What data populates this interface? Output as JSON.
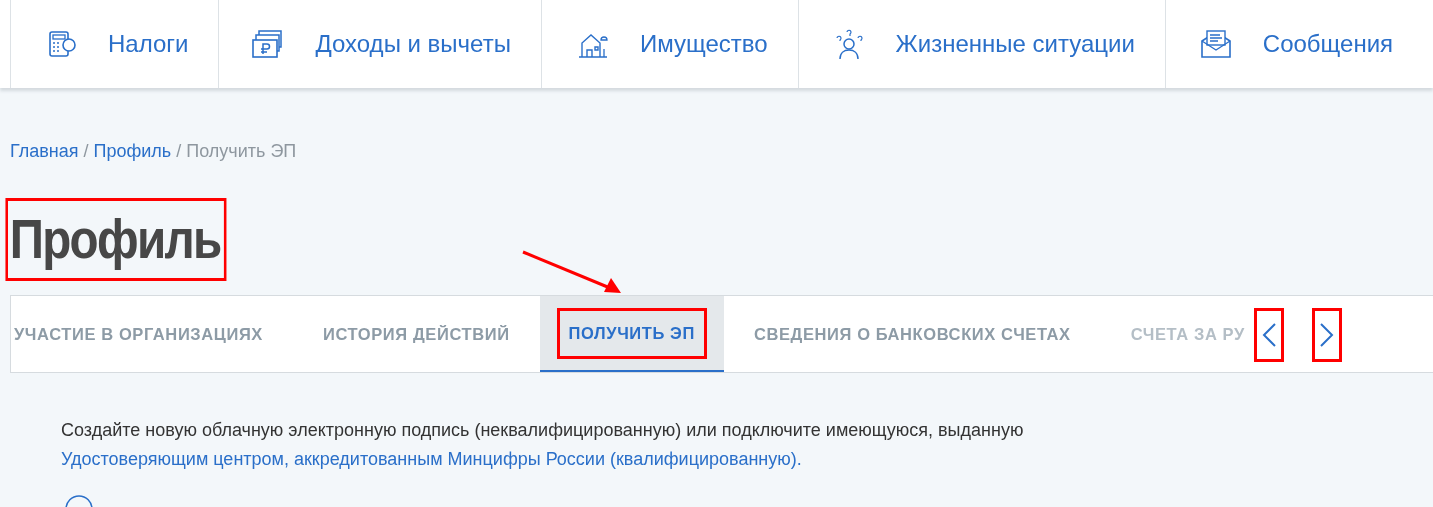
{
  "top_nav": [
    {
      "label": "Налоги"
    },
    {
      "label": "Доходы и вычеты"
    },
    {
      "label": "Имущество"
    },
    {
      "label": "Жизненные ситуации"
    },
    {
      "label": "Сообщения"
    }
  ],
  "breadcrumb_separators": [
    "/",
    "/"
  ],
  "breadcrumbs": [
    {
      "label": "Главная",
      "current": false
    },
    {
      "label": "Профиль",
      "current": false
    },
    {
      "label": "Получить ЭП",
      "current": true
    }
  ],
  "page_title": {
    "text": "Профиль",
    "highlighted": true
  },
  "annotation_arrow": true,
  "tabs": [
    {
      "label": "УЧАСТИЕ В ОРГАНИЗАЦИЯХ",
      "selected": false,
      "highlighted": false
    },
    {
      "label": "ИСТОРИЯ ДЕЙСТВИЙ",
      "selected": false,
      "highlighted": false
    },
    {
      "label": "ПОЛУЧИТЬ ЭП",
      "selected": true,
      "highlighted": true
    },
    {
      "label": "СВЕДЕНИЯ О БАНКОВСКИХ СЧЕТАХ",
      "selected": false,
      "highlighted": false
    },
    {
      "label": "СЧЕТА ЗА РУ",
      "selected": false,
      "highlighted": false
    }
  ],
  "tab_scroll": {
    "prev_highlighted": true,
    "next_highlighted": true
  },
  "intro": [
    {
      "kind": "text",
      "text": "Создайте новую облачную электронную подпись (неквалифицированную) или подключите имеющуюся, выданную "
    },
    {
      "kind": "link",
      "text": "Удостоверяющим "
    },
    {
      "kind": "link",
      "text": "центром, аккредитованным Минцифры России (квалифицированную)."
    }
  ]
}
